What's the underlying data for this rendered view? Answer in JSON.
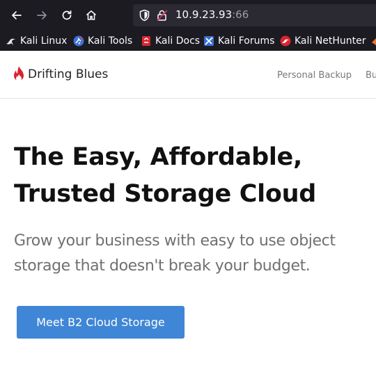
{
  "browser": {
    "url_host": "10.9.23.93",
    "url_port": ":66",
    "bookmarks": [
      {
        "label": "Kali Linux",
        "icon": "kali-dragon-icon"
      },
      {
        "label": "Kali Tools",
        "icon": "kali-tools-icon"
      },
      {
        "label": "Kali Docs",
        "icon": "kali-docs-icon"
      },
      {
        "label": "Kali Forums",
        "icon": "kali-forums-icon"
      },
      {
        "label": "Kali NetHunter",
        "icon": "kali-nethunter-icon"
      }
    ]
  },
  "site": {
    "brand": "Drifting Blues",
    "nav": [
      "Personal Backup",
      "Bu"
    ],
    "hero": {
      "title_line1": "The Easy, Affordable,",
      "title_line2": "Trusted Storage Cloud",
      "subtitle_line1": "Grow your business with easy to use object",
      "subtitle_line2": "storage that doesn't break your budget.",
      "cta_label": "Meet B2 Cloud Storage"
    }
  },
  "colors": {
    "chrome_bg": "#1c1b22",
    "urlbar_bg": "#2b2a33",
    "brand_red": "#d9242f",
    "cta_blue": "#3f86d6"
  }
}
